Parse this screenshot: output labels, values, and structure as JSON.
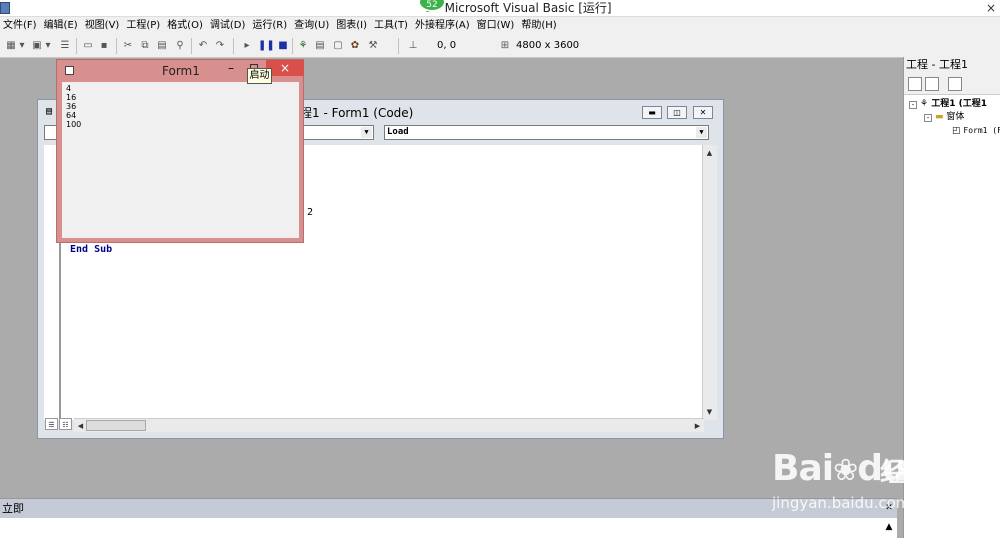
{
  "window": {
    "title": "1 - Microsoft Visual Basic [运行]",
    "badge": "52"
  },
  "menu": [
    "文件(F)",
    "编辑(E)",
    "视图(V)",
    "工程(P)",
    "格式(O)",
    "调试(D)",
    "运行(R)",
    "查询(U)",
    "图表(I)",
    "工具(T)",
    "外接程序(A)",
    "窗口(W)",
    "帮助(H)"
  ],
  "toolbar": {
    "position": "0, 0",
    "size": "4800 x 3600"
  },
  "code_window": {
    "title": "程1 - Form1 (Code)",
    "procedure": "Load",
    "code_partial": "2",
    "code_end": "End Sub",
    "colors": {
      "keyword": "#00008b"
    }
  },
  "form1": {
    "title": "Form1",
    "close": "×",
    "output": [
      "4",
      "16",
      "36",
      "64",
      "100"
    ],
    "colors": {
      "frame": "#d8908e",
      "close": "#d9504a"
    }
  },
  "tooltip": "启动",
  "project": {
    "title": "工程 - 工程1",
    "root": "工程1 (工程1",
    "folder": "窗体",
    "form": "Form1 (F"
  },
  "immediate": {
    "title": "立即"
  },
  "watermark": {
    "brand": "Bai",
    "brand2": "du",
    "cn": "经验",
    "url": "jingyan.baidu.com"
  }
}
